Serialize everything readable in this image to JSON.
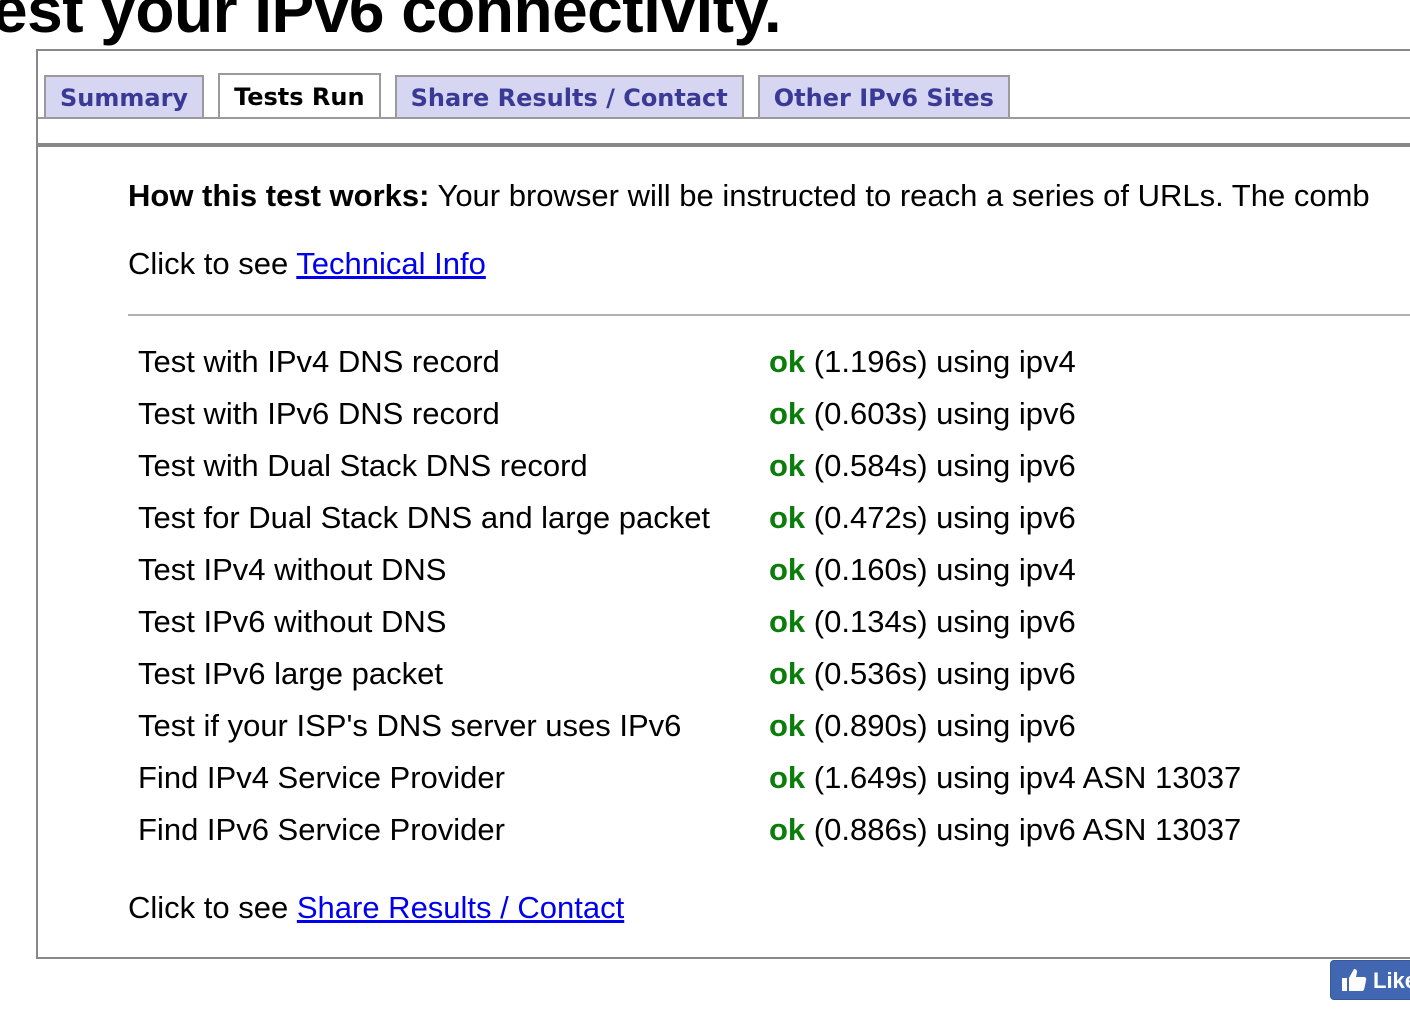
{
  "headline": "est your IPv6 connectivity.",
  "tabs": [
    {
      "label": "Summary",
      "active": false
    },
    {
      "label": "Tests Run",
      "active": true
    },
    {
      "label": "Share Results / Contact",
      "active": false
    },
    {
      "label": "Other IPv6 Sites",
      "active": false
    }
  ],
  "intro": {
    "bold": "How this test works:",
    "text": " Your browser will be instructed to reach a series of URLs. The comb"
  },
  "technical": {
    "prefix": "Click to see ",
    "link": "Technical Info"
  },
  "tests": [
    {
      "label": "Test with IPv4 DNS record",
      "status": "ok",
      "detail": " (1.196s) using ipv4"
    },
    {
      "label": "Test with IPv6 DNS record",
      "status": "ok",
      "detail": " (0.603s) using ipv6"
    },
    {
      "label": "Test with Dual Stack DNS record",
      "status": "ok",
      "detail": " (0.584s) using ipv6"
    },
    {
      "label": "Test for Dual Stack DNS and large packet",
      "status": "ok",
      "detail": " (0.472s) using ipv6"
    },
    {
      "label": "Test IPv4 without DNS",
      "status": "ok",
      "detail": " (0.160s) using ipv4"
    },
    {
      "label": "Test IPv6 without DNS",
      "status": "ok",
      "detail": " (0.134s) using ipv6"
    },
    {
      "label": "Test IPv6 large packet",
      "status": "ok",
      "detail": " (0.536s) using ipv6"
    },
    {
      "label": "Test if your ISP's DNS server uses IPv6",
      "status": "ok",
      "detail": " (0.890s) using ipv6"
    },
    {
      "label": "Find IPv4 Service Provider",
      "status": "ok",
      "detail": " (1.649s) using ipv4 ASN 13037"
    },
    {
      "label": "Find IPv6 Service Provider",
      "status": "ok",
      "detail": " (0.886s) using ipv6 ASN 13037"
    }
  ],
  "share": {
    "prefix": "Click to see ",
    "link": "Share Results / Contact"
  },
  "like_button": {
    "label": "Like",
    "icon": "thumbs-up-icon"
  },
  "colors": {
    "ok": "#0a7d0a",
    "link": "#0000ee",
    "tab_bg": "#d6d6f2",
    "tab_text": "#3a3a96",
    "like_bg": "#4267b2"
  }
}
